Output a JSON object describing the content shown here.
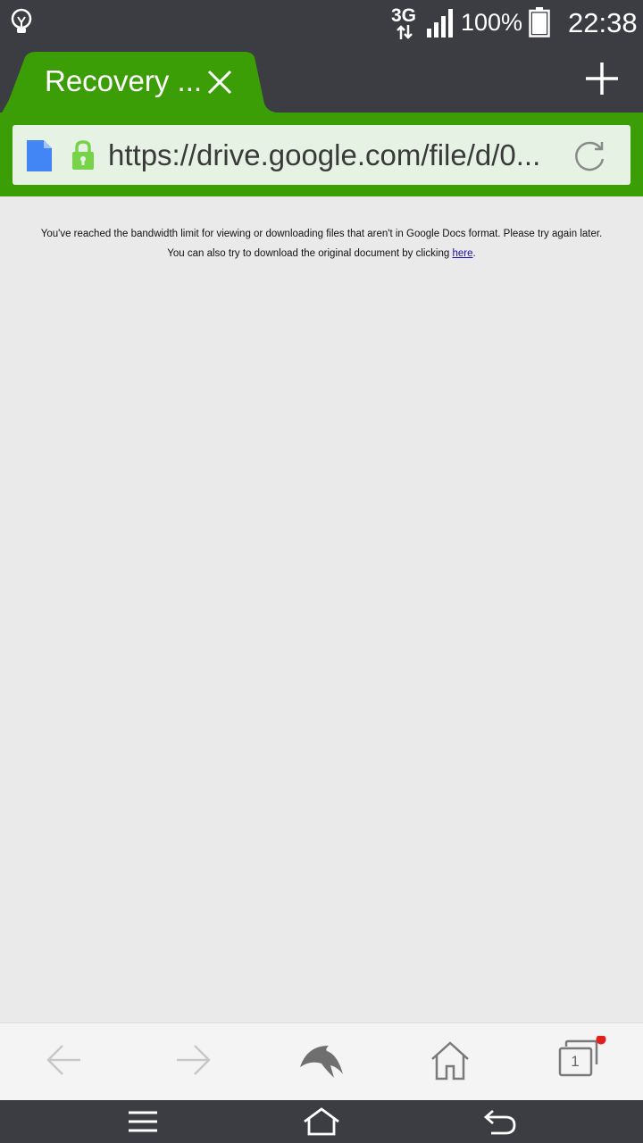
{
  "status_bar": {
    "network": "3G",
    "battery_percent": "100%",
    "time": "22:38",
    "icons": [
      "lightbulb-icon",
      "data-arrows-icon",
      "signal-icon",
      "battery-icon"
    ]
  },
  "tab": {
    "title": "Recovery ..."
  },
  "address_bar": {
    "url": "https://drive.google.com/file/d/0..."
  },
  "page": {
    "message_line1": "You've reached the bandwidth limit for viewing or downloading files that aren't in Google Docs format. Please try again later.",
    "message_line2_prefix": "You can also try to download the original document by clicking ",
    "message_link": "here",
    "message_line2_suffix": "."
  },
  "bottom_bar": {
    "tab_count": "1"
  },
  "colors": {
    "toolbar_green": "#3c9e07",
    "chrome_dark": "#3b3d42",
    "url_box": "#e6f3e4",
    "notification_dot": "#e02020"
  }
}
